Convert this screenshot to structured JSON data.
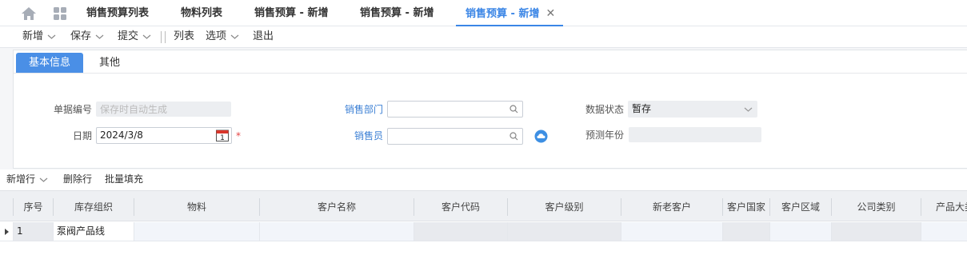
{
  "tabs": {
    "items": [
      {
        "label": "销售预算列表"
      },
      {
        "label": "物料列表"
      },
      {
        "label": "销售预算 - 新增"
      },
      {
        "label": "销售预算 - 新增"
      },
      {
        "label": "销售预算 - 新增",
        "active": true
      }
    ],
    "close_glyph": "✕"
  },
  "toolbar": {
    "new": "新增",
    "save": "保存",
    "submit": "提交",
    "list": "列表",
    "options": "选项",
    "exit": "退出"
  },
  "form_tabs": {
    "basic": "基本信息",
    "other": "其他"
  },
  "form": {
    "doc_no_label": "单据编号",
    "doc_no_placeholder": "保存时自动生成",
    "date_label": "日期",
    "date_value": "2024/3/8",
    "calendar_day": "1",
    "required_mark": "*",
    "dept_label": "销售部门",
    "dept_value": "",
    "salesman_label": "销售员",
    "salesman_value": "",
    "status_label": "数据状态",
    "status_value": "暂存",
    "forecast_year_label": "预测年份",
    "forecast_year_value": ""
  },
  "grid_tools": {
    "add_row": "新增行",
    "delete_row": "删除行",
    "batch_fill": "批量填充"
  },
  "grid": {
    "columns": [
      "序号",
      "库存组织",
      "物料",
      "客户名称",
      "客户代码",
      "客户级别",
      "新老客户",
      "客户国家",
      "客户区域",
      "公司类别",
      "产品大类"
    ],
    "rows": [
      {
        "seq": "1",
        "org": "泵阀产品线"
      }
    ]
  },
  "colors": {
    "accent": "#3b86e6",
    "active_tab_bg": "#4a8fe6",
    "required": "#e54545"
  }
}
